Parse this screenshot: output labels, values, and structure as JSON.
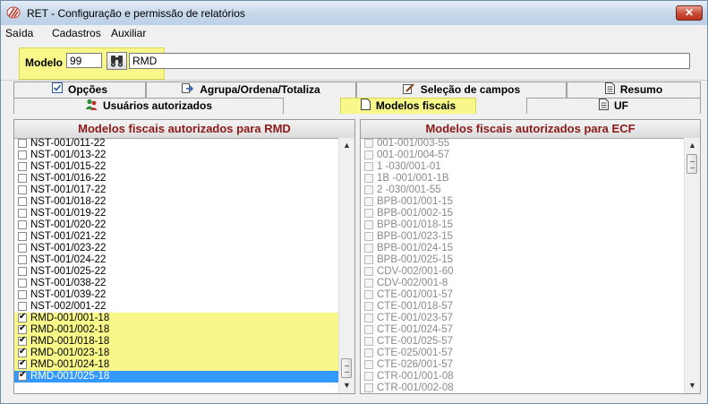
{
  "window": {
    "title": "RET - Configuração e permissão de relatórios",
    "close_label": "✕"
  },
  "menu": [
    "Saída",
    "Cadastros",
    "Auxiliar"
  ],
  "model": {
    "label": "Modelo",
    "code": "99",
    "name": "RMD"
  },
  "tabs_row1": [
    {
      "label": "Opções",
      "icon": "checkbox-icon"
    },
    {
      "label": "Agrupa/Ordena/Totaliza",
      "icon": "export-icon"
    },
    {
      "label": "Seleção de campos",
      "icon": "edit-icon"
    },
    {
      "label": "Resumo",
      "icon": "document-icon"
    }
  ],
  "tabs_row2": [
    {
      "label": "Usuários autorizados",
      "icon": "users-icon"
    },
    {
      "label": "Modelos fiscais",
      "icon": "page-icon",
      "active": true
    },
    {
      "label": "UF",
      "icon": "document-icon"
    }
  ],
  "left_panel": {
    "title": "Modelos fiscais autorizados para RMD",
    "items": [
      {
        "label": "NST-001/011-22",
        "checked": false
      },
      {
        "label": "NST-001/013-22",
        "checked": false
      },
      {
        "label": "NST-001/015-22",
        "checked": false
      },
      {
        "label": "NST-001/016-22",
        "checked": false
      },
      {
        "label": "NST-001/017-22",
        "checked": false
      },
      {
        "label": "NST-001/018-22",
        "checked": false
      },
      {
        "label": "NST-001/019-22",
        "checked": false
      },
      {
        "label": "NST-001/020-22",
        "checked": false
      },
      {
        "label": "NST-001/021-22",
        "checked": false
      },
      {
        "label": "NST-001/023-22",
        "checked": false
      },
      {
        "label": "NST-001/024-22",
        "checked": false
      },
      {
        "label": "NST-001/025-22",
        "checked": false
      },
      {
        "label": "NST-001/038-22",
        "checked": false
      },
      {
        "label": "NST-001/039-22",
        "checked": false
      },
      {
        "label": "NST-002/001-22",
        "checked": false
      },
      {
        "label": "RMD-001/001-18",
        "checked": true,
        "highlight": true
      },
      {
        "label": "RMD-001/002-18",
        "checked": true,
        "highlight": true
      },
      {
        "label": "RMD-001/018-18",
        "checked": true,
        "highlight": true
      },
      {
        "label": "RMD-001/023-18",
        "checked": true,
        "highlight": true
      },
      {
        "label": "RMD-001/024-18",
        "checked": true,
        "highlight": true
      },
      {
        "label": "RMD-001/025-18",
        "checked": true,
        "selected": true
      }
    ]
  },
  "right_panel": {
    "title": "Modelos fiscais autorizados para ECF",
    "items": [
      "001-001/003-55",
      "001-001/004-57",
      "1  -030/001-01",
      "1B -001/001-1B",
      "2  -030/001-55",
      "BPB-001/001-15",
      "BPB-001/002-15",
      "BPB-001/018-15",
      "BPB-001/023-15",
      "BPB-001/024-15",
      "BPB-001/025-15",
      "CDV-002/001-60",
      "CDV-002/001-8",
      "CTE-001/001-57",
      "CTE-001/018-57",
      "CTE-001/023-57",
      "CTE-001/024-57",
      "CTE-001/025-57",
      "CTE-025/001-57",
      "CTE-026/001-57",
      "CTR-001/001-08",
      "CTR-001/002-08"
    ]
  },
  "colors": {
    "highlight": "#f7f78a",
    "selection": "#3399ff",
    "panel_title": "#8b1a1a"
  }
}
